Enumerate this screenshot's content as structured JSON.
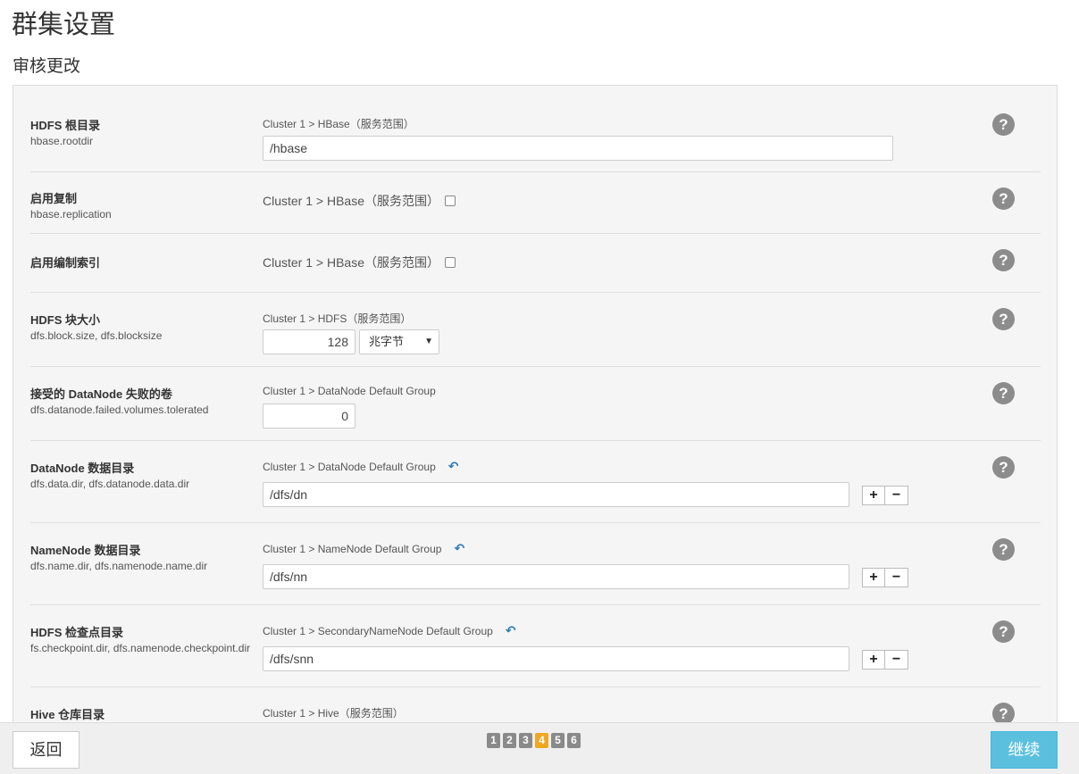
{
  "page": {
    "title": "群集设置",
    "section_title": "审核更改"
  },
  "settings": [
    {
      "label": "HDFS 根目录",
      "key": "hbase.rootdir",
      "scope": "Cluster 1 > HBase（服务范围）",
      "value": "/hbase"
    },
    {
      "label": "启用复制",
      "key": "hbase.replication",
      "scope": "Cluster 1 > HBase（服务范围）",
      "checked": false
    },
    {
      "label": "启用编制索引",
      "scope": "Cluster 1 > HBase（服务范围）",
      "checked": false
    },
    {
      "label": "HDFS 块大小",
      "key": "dfs.block.size, dfs.blocksize",
      "scope": "Cluster 1 > HDFS（服务范围）",
      "value": "128",
      "unit": "兆字节"
    },
    {
      "label": "接受的 DataNode 失败的卷",
      "key": "dfs.datanode.failed.volumes.tolerated",
      "scope": "Cluster 1 > DataNode Default Group",
      "value": "0"
    },
    {
      "label": "DataNode 数据目录",
      "key": "dfs.data.dir, dfs.datanode.data.dir",
      "scope": "Cluster 1 > DataNode Default Group",
      "value": "/dfs/dn"
    },
    {
      "label": "NameNode 数据目录",
      "key": "dfs.name.dir, dfs.namenode.name.dir",
      "scope": "Cluster 1 > NameNode Default Group",
      "value": "/dfs/nn"
    },
    {
      "label": "HDFS 检查点目录",
      "key": "fs.checkpoint.dir, dfs.namenode.checkpoint.dir",
      "scope": "Cluster 1 > SecondaryNameNode Default Group",
      "value": "/dfs/snn"
    },
    {
      "label": "Hive 仓库目录",
      "scope": "Cluster 1 > Hive（服务范围）"
    }
  ],
  "icons": {
    "help": "?",
    "undo": "↶",
    "plus": "+",
    "minus": "−",
    "caret": "▼"
  },
  "footer": {
    "back_label": "返回",
    "continue_label": "继续",
    "steps": [
      "1",
      "2",
      "3",
      "4",
      "5",
      "6"
    ],
    "active_step": "4"
  },
  "colors": {
    "primary_button": "#5bc0de",
    "active_step": "#f0a722",
    "inactive_step": "#8a8a8a",
    "help_icon": "#8c8c8c",
    "undo_icon": "#2a7ab8"
  }
}
